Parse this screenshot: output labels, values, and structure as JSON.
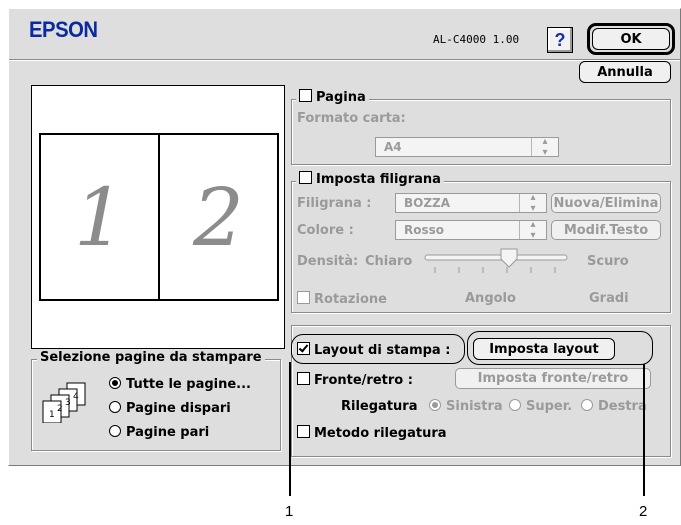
{
  "header": {
    "brand": "EPSON",
    "model": "AL-C4000  1.00",
    "help_glyph": "?",
    "ok_label": "OK",
    "cancel_label": "Annulla"
  },
  "preview": {
    "page_left": "1",
    "page_right": "2"
  },
  "pagina": {
    "title": "Pagina",
    "checked": false,
    "paper_label": "Formato carta:",
    "paper_value": "A4"
  },
  "watermark": {
    "title": "Imposta filigrana",
    "checked": false,
    "filigrana_label": "Filigrana :",
    "filigrana_value": "BOZZA",
    "nuova_button": "Nuova/Elimina",
    "colore_label": "Colore :",
    "colore_value": "Rosso",
    "modif_button": "Modif.Testo",
    "densita_label": "Densità:",
    "chiaro": "Chiaro",
    "scuro": "Scuro",
    "rotazione_label": "Rotazione",
    "angolo": "Angolo",
    "gradi": "Gradi"
  },
  "page_selection": {
    "title": "Selezione pagine da stampare",
    "options": [
      "Tutte le pagine...",
      "Pagine dispari",
      "Pagine pari"
    ],
    "selected": 0
  },
  "layout": {
    "layout_label": "Layout di stampa :",
    "layout_checked": true,
    "imposta_layout_button": "Imposta layout",
    "fronte_label": "Fronte/retro :",
    "fronte_checked": false,
    "fronte_button": "Imposta fronte/retro",
    "rilegatura_label": "Rilegatura",
    "rilegatura_options": [
      "Sinistra",
      "Super.",
      "Destra"
    ],
    "rilegatura_selected": 0,
    "metodo_label": "Metodo rilegatura",
    "metodo_checked": false
  },
  "callouts": {
    "one": "1",
    "two": "2"
  }
}
